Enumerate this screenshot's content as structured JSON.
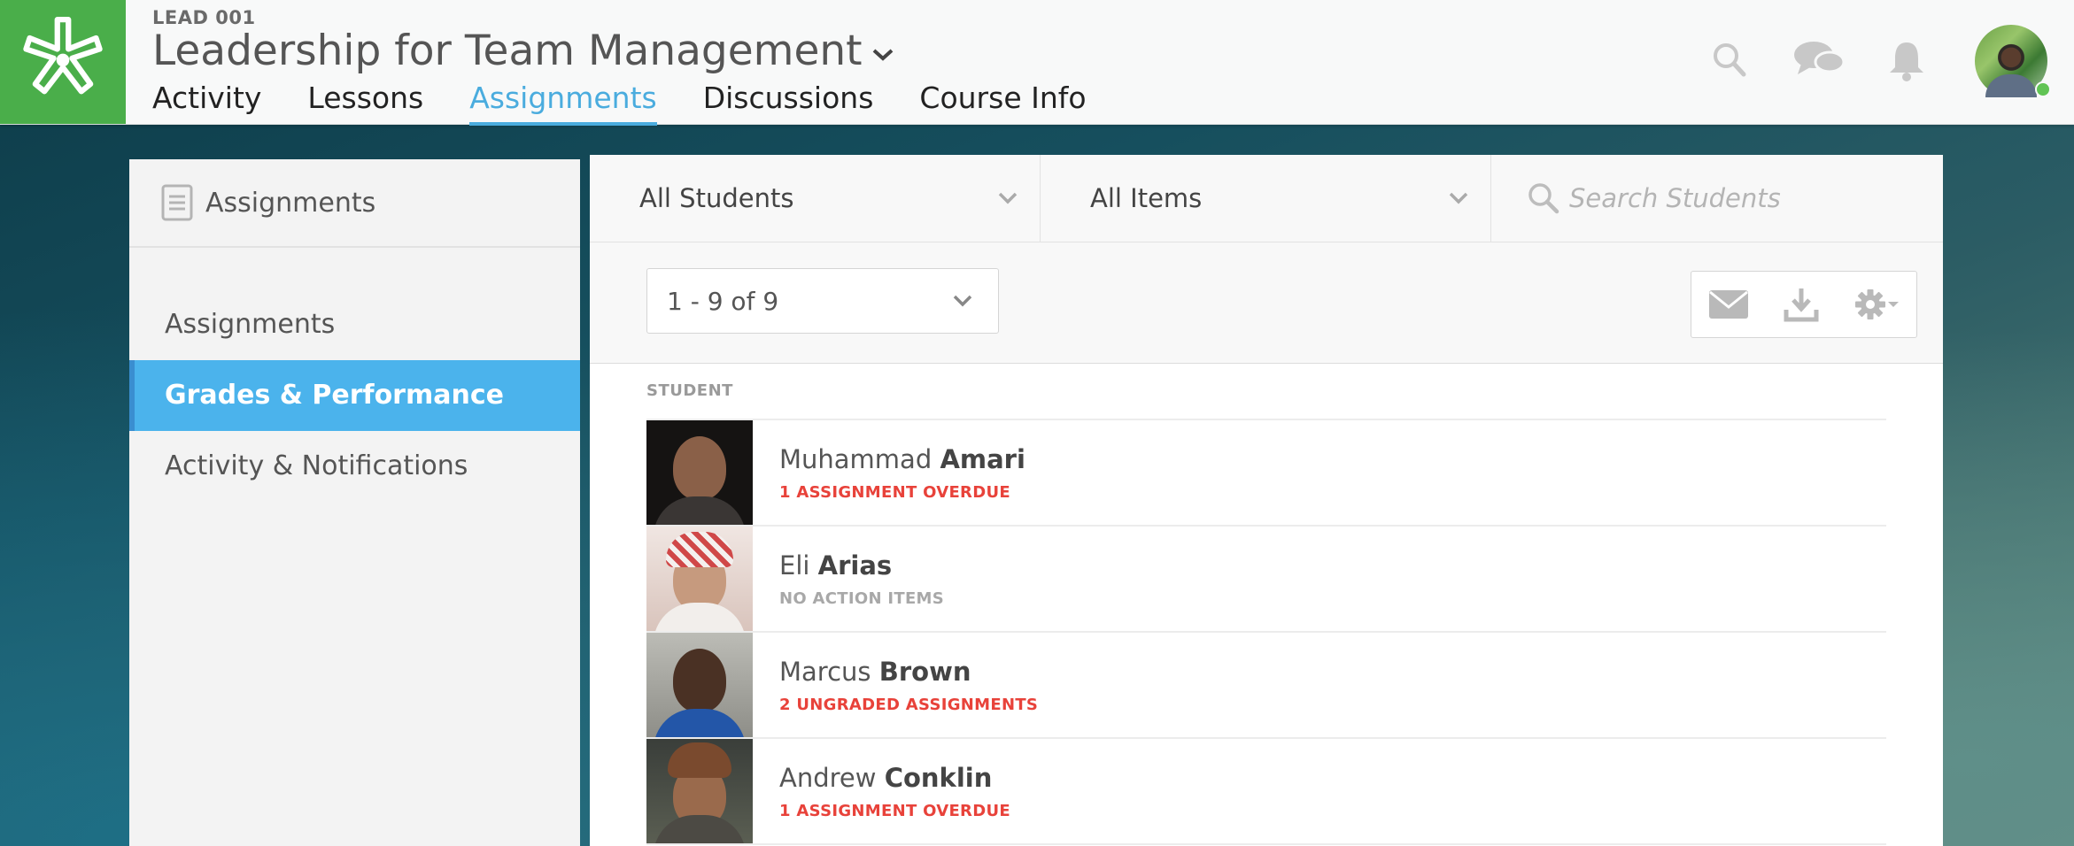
{
  "header": {
    "course_code": "LEAD 001",
    "course_title": "Leadership for Team Management",
    "tabs": [
      {
        "label": "Activity",
        "active": false
      },
      {
        "label": "Lessons",
        "active": false
      },
      {
        "label": "Assignments",
        "active": true
      },
      {
        "label": "Discussions",
        "active": false
      },
      {
        "label": "Course Info",
        "active": false
      }
    ],
    "icons": [
      "search-icon",
      "chat-icon",
      "bell-icon"
    ],
    "user_status": "online"
  },
  "sidebar": {
    "title": "Assignments",
    "items": [
      {
        "label": "Assignments",
        "active": false
      },
      {
        "label": "Grades & Performance",
        "active": true
      },
      {
        "label": "Activity & Notifications",
        "active": false
      }
    ]
  },
  "filters": {
    "students_select": "All Students",
    "items_select": "All Items",
    "search_placeholder": "Search Students"
  },
  "toolbar": {
    "pagination": "1 - 9 of 9",
    "actions": [
      "email-icon",
      "download-icon",
      "settings-icon"
    ]
  },
  "table": {
    "column_header": "STUDENT",
    "rows": [
      {
        "first": "Muhammad",
        "last": "Amari",
        "status": "1 ASSIGNMENT OVERDUE",
        "status_color": "#e8423a"
      },
      {
        "first": "Eli",
        "last": "Arias",
        "status": "NO ACTION ITEMS",
        "status_color": "#a8a8a8"
      },
      {
        "first": "Marcus",
        "last": "Brown",
        "status": "2 UNGRADED ASSIGNMENTS",
        "status_color": "#e8423a"
      },
      {
        "first": "Andrew",
        "last": "Conklin",
        "status": "1 ASSIGNMENT OVERDUE",
        "status_color": "#e8423a"
      }
    ]
  },
  "colors": {
    "brand_green": "#4aae4a",
    "accent_blue": "#4aacde",
    "sidebar_active": "#4bb3ec",
    "alert_red": "#e8423a"
  }
}
